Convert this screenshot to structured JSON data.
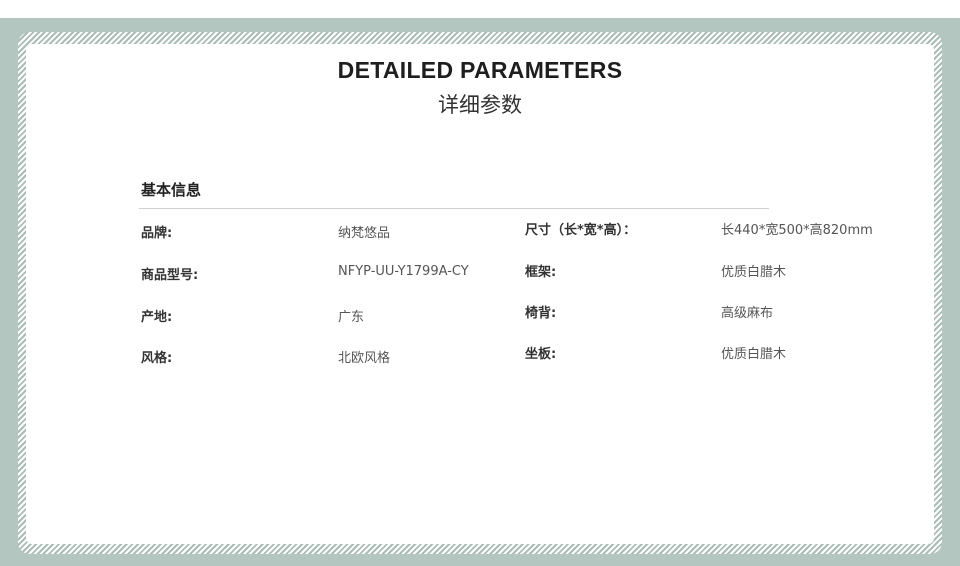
{
  "header": {
    "title_en": "DETAILED PARAMETERS",
    "title_cn": "详细参数"
  },
  "section": {
    "title": "基本信息"
  },
  "params": {
    "brand_label": "品牌:",
    "brand_value": "纳梵悠品",
    "model_label": "商品型号:",
    "model_value": "NFYP-UU-Y1799A-CY",
    "origin_label": "产地:",
    "origin_value": "广东",
    "style_label": "风格:",
    "style_value": "北欧风格",
    "size_label": "尺寸（长*宽*高）：",
    "size_value": "长440*宽500*高820mm",
    "frame_label": "框架:",
    "frame_value": "优质白腊木",
    "back_label": "椅背:",
    "back_value": "高级麻布",
    "seat_label": "坐板:",
    "seat_value": "优质白腊木"
  },
  "colors": {
    "border": "#b3c6c0",
    "hatch": "#a9bdb6",
    "background": "#ffffff"
  }
}
